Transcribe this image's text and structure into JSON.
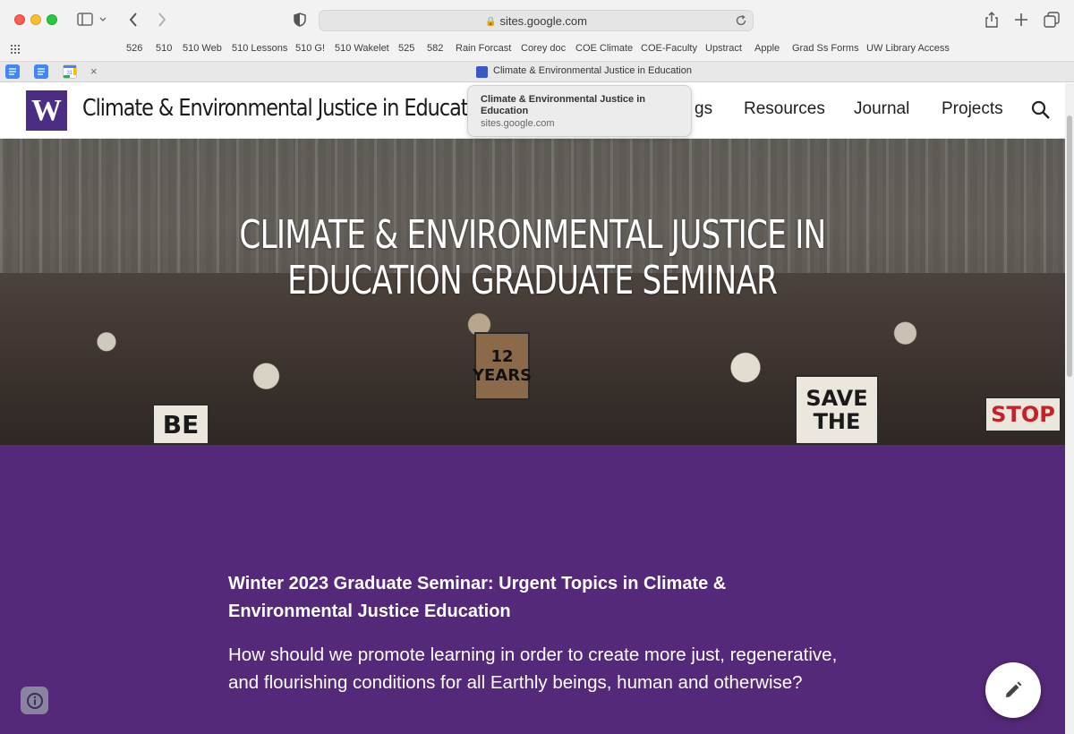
{
  "browser": {
    "url": "sites.google.com",
    "bookmarks": [
      "526",
      "510",
      "510 Web",
      "510 Lessons",
      "510 G!",
      "510 Wakelet",
      "525",
      "582",
      "Rain Forcast",
      "Corey doc",
      "COE Climate",
      "COE-Faculty",
      "Upstract",
      "Apple",
      "Grad Ss Forms",
      "UW Library Access"
    ],
    "active_tab_title": "Climate & Environmental Justice in Education",
    "tab_close": "×"
  },
  "tooltip": {
    "title": "Climate & Environmental Justice in Education",
    "url": "sites.google.com"
  },
  "site": {
    "logo_letter": "W",
    "title": "Climate & Environmental Justice in Education",
    "nav": {
      "partial": "gs",
      "resources": "Resources",
      "journal": "Journal",
      "projects": "Projects"
    }
  },
  "hero": {
    "title_line1": "CLIMATE & ENVIRONMENTAL JUSTICE IN",
    "title_line2": "EDUCATION GRADUATE SEMINAR",
    "signs": [
      "SAVE THE",
      "STOP",
      "BE",
      "12 YEARS"
    ]
  },
  "content": {
    "heading": "Winter 2023 Graduate Seminar: Urgent Topics in Climate & Environmental Justice Education",
    "question": "How should we promote learning in order to create more just, regenerative, and flourishing conditions for all Earthly beings, human and otherwise?"
  },
  "colors": {
    "uw_purple": "#4b2e83",
    "content_bg": "#55297a"
  }
}
